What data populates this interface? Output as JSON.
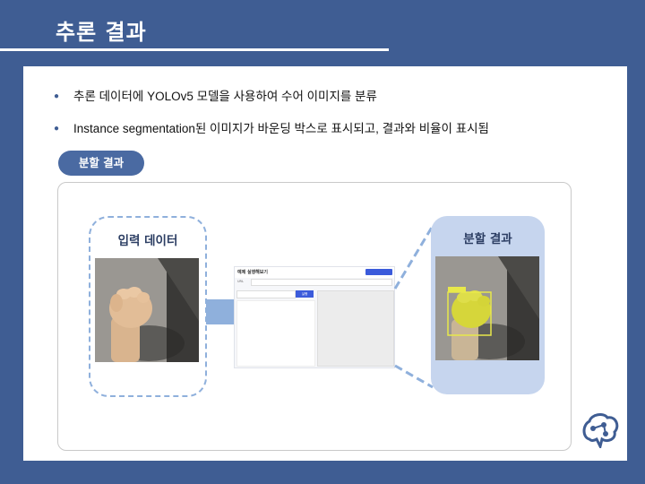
{
  "header": {
    "title": "추론 결과"
  },
  "bullets": [
    "추론 데이터에 YOLOv5 모델을 사용하여 수어 이미지를 분류",
    "Instance segmentation된 이미지가 바운딩 박스로 표시되고, 결과와 비율이 표시됨"
  ],
  "section_pill": "분할 결과",
  "diagram": {
    "input_label": "입력 데이터",
    "result_label": "분할 결과",
    "app_title": "예제 실행해보기",
    "app_url_label": "URL",
    "app_run_button": "실행"
  },
  "colors": {
    "background": "#3f5d93",
    "accent": "#4a6aa2",
    "dashed_border": "#8fb0dc",
    "result_panel": "#c6d5ee",
    "mask": "#d6d63a"
  },
  "icons": {
    "logo": "brain-network-icon",
    "arrow": "right-arrow-icon"
  }
}
